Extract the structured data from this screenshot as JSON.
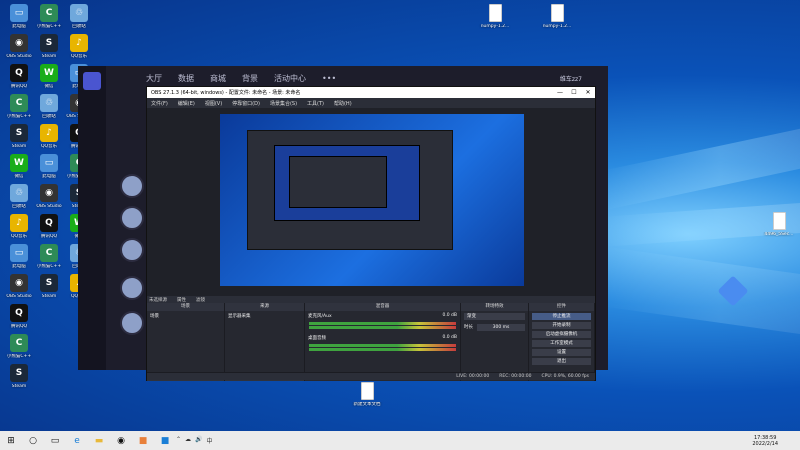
{
  "desktop": {
    "icons": [
      {
        "label": "此电脑",
        "color": "#4a90d9",
        "glyph": "▭"
      },
      {
        "label": "小熊猫C++",
        "color": "#2e8b57",
        "glyph": "C"
      },
      {
        "label": "回收站",
        "color": "#6fa8dc",
        "glyph": "♲"
      },
      {
        "label": "OBS Studio",
        "color": "#333",
        "glyph": "◉"
      },
      {
        "label": "Steam",
        "color": "#1b2838",
        "glyph": "S"
      },
      {
        "label": "QQ音乐",
        "color": "#e8b500",
        "glyph": "♪"
      },
      {
        "label": "腾讯QQ",
        "color": "#111",
        "glyph": "Q"
      },
      {
        "label": "微信",
        "color": "#1aad19",
        "glyph": "W"
      }
    ],
    "files": [
      {
        "label": "numpy-1.2...",
        "glyph": "▯"
      },
      {
        "label": "numpy-1.2...",
        "glyph": "▯"
      },
      {
        "label": "4496_5Sec...",
        "glyph": "▯"
      },
      {
        "label": "新建文本文档",
        "glyph": "▯"
      }
    ]
  },
  "bgapp": {
    "tabs": [
      "大厅",
      "数据",
      "商城",
      "背景",
      "活动中心",
      "•••"
    ],
    "username": "维车zz7"
  },
  "obs": {
    "window_title": "OBS 27.1.3 (64-bit, windows) - 配置文件: 未命名 - 场景: 未命名",
    "menu": [
      "文件(F)",
      "编辑(E)",
      "视图(V)",
      "停靠窗口(D)",
      "场景集合(S)",
      "工具(T)",
      "帮助(H)"
    ],
    "scene_label": "未选择源",
    "scene_props": [
      "属性",
      "滤镜"
    ],
    "docks": {
      "scenes": {
        "title": "场景",
        "items": [
          "场景"
        ]
      },
      "sources": {
        "title": "来源",
        "items": [
          "显示器采集"
        ]
      },
      "mixer": {
        "title": "混音器",
        "tracks": [
          {
            "name": "桌面音频",
            "db": "0.0 dB"
          },
          {
            "name": "麦克风/Aux",
            "db": "0.0 dB"
          }
        ]
      },
      "transitions": {
        "title": "转场特效",
        "type": "渐变",
        "duration_label": "时长",
        "duration": "300 ms"
      },
      "controls": {
        "title": "控件",
        "buttons": [
          "停止推流",
          "开始录制",
          "启动虚拟摄像机",
          "工作室模式",
          "设置",
          "退出"
        ]
      }
    },
    "status": {
      "live": "LIVE: 00:00:00",
      "rec": "REC: 00:00:00",
      "cpu": "CPU: 0.9%, 60.00 fps"
    }
  },
  "taskbar": {
    "time": "17:38:59",
    "date": "2022/2/14"
  }
}
